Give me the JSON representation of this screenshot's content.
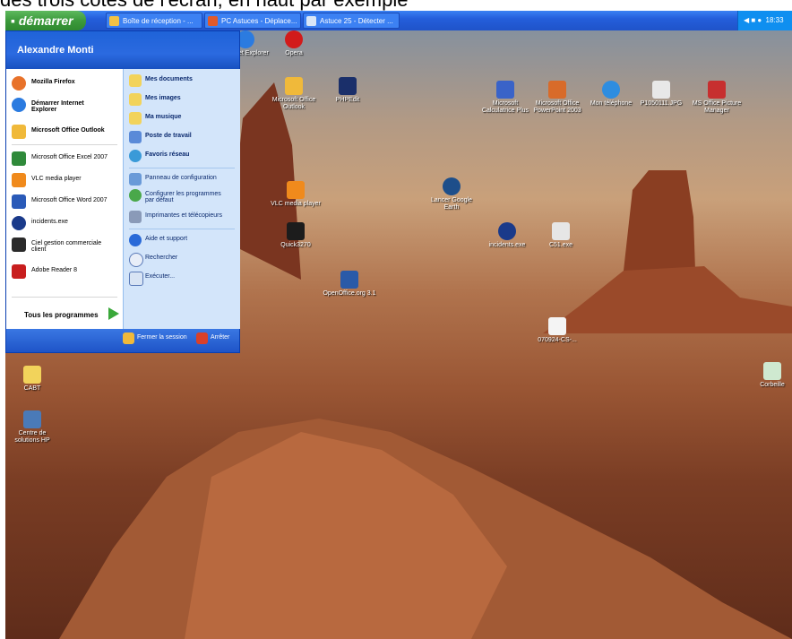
{
  "caption": "des trois côtés de l'écran, en haut par exemple",
  "taskbar": {
    "start_label": "démarrer",
    "tasks": [
      "Boîte de réception - ...",
      "PC Astuces - Déplace...",
      "Astuce 25 - Détecter ..."
    ],
    "clock": "18:33"
  },
  "start_menu": {
    "user": "Alexandre Monti",
    "pinned": [
      "Mozilla Firefox",
      "Démarrer Internet Explorer",
      "Microsoft Office Outlook"
    ],
    "recent": [
      "Microsoft Office Excel 2007",
      "VLC media player",
      "Microsoft Office Word 2007",
      "incidents.exe",
      "Ciel gestion commerciale client",
      "Adobe Reader 8"
    ],
    "all_programs": "Tous les programmes",
    "right_bold": [
      "Mes documents",
      "Mes images",
      "Ma musique",
      "Poste de travail",
      "Favoris réseau"
    ],
    "right_normal": [
      "Panneau de configuration",
      "Configurer les programmes par défaut",
      "Imprimantes et télécopieurs",
      "Aide et support",
      "Rechercher",
      "Exécuter..."
    ],
    "logoff": "Fermer la session",
    "shutdown": "Arrêter"
  },
  "desktop_icons": [
    {
      "label": "Opera"
    },
    {
      "label": "Internet Explorer"
    },
    {
      "label": "Microsoft Office Outlook"
    },
    {
      "label": "PHPEdit"
    },
    {
      "label": "Microsoft Calculatrice Plus"
    },
    {
      "label": "Microsoft Office PowerPoint 2003"
    },
    {
      "label": "Mon téléphone"
    },
    {
      "label": "P1050111.JPG"
    },
    {
      "label": "MS Office Picture Manager"
    },
    {
      "label": "Lancer Google Earth"
    },
    {
      "label": "VLC media player"
    },
    {
      "label": "Quick3270"
    },
    {
      "label": "incidents.exe"
    },
    {
      "label": "C51.exe"
    },
    {
      "label": "OpenOffice.org 3.1"
    },
    {
      "label": "070924-CS-..."
    },
    {
      "label": "CABT"
    },
    {
      "label": "Centre de solutions HP"
    },
    {
      "label": "Corbeille"
    }
  ]
}
